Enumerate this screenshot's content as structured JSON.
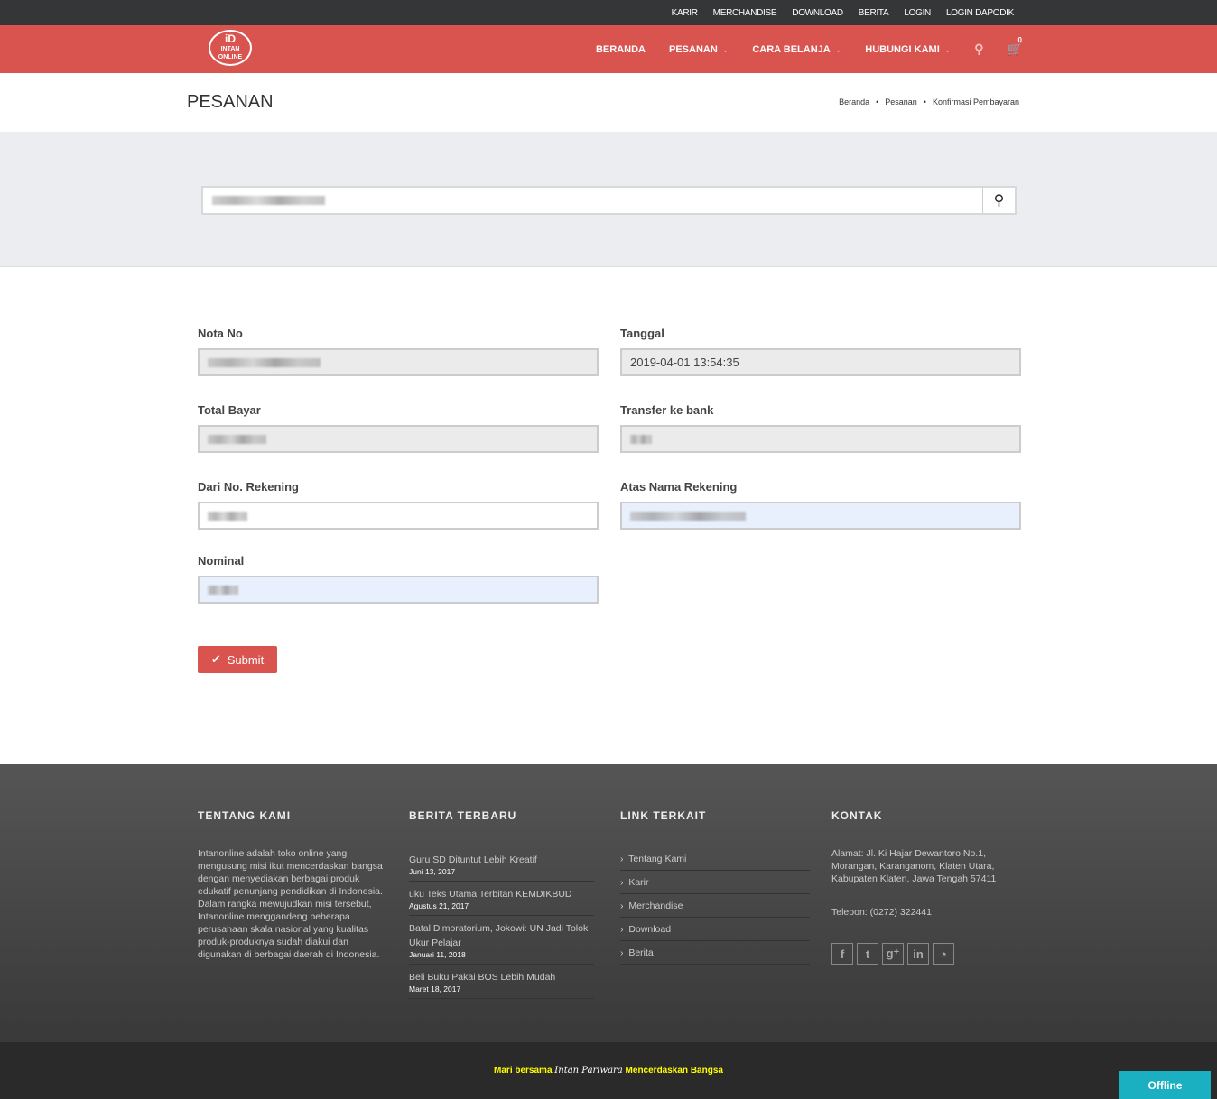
{
  "topbar": {
    "items": [
      "KARIR",
      "MERCHANDISE",
      "DOWNLOAD",
      "BERITA",
      "LOGIN",
      "LOGIN DAPODIK"
    ]
  },
  "nav": {
    "logo": "INTAN ONLINE",
    "items": [
      "BERANDA",
      "PESANAN",
      "CARA BELANJA",
      "HUBUNGI KAMI"
    ],
    "cart_count": "0"
  },
  "page": {
    "title": "PESANAN",
    "breadcrumb": [
      "Beranda",
      "Pesanan",
      "Konfirmasi Pembayaran"
    ]
  },
  "form": {
    "nota_label": "Nota No",
    "tanggal_label": "Tanggal",
    "tanggal_value": "2019-04-01 13:54:35",
    "total_label": "Total Bayar",
    "bank_label": "Transfer ke bank",
    "rek_label": "Dari No. Rekening",
    "nama_label": "Atas Nama Rekening",
    "nominal_label": "Nominal",
    "submit": "Submit"
  },
  "footer": {
    "about_title": "TENTANG KAMI",
    "about_text": "Intanonline adalah toko online yang mengusung misi ikut mencerdaskan bangsa dengan menyediakan berbagai produk edukatif penunjang pendidikan di Indonesia. Dalam rangka mewujudkan misi tersebut, Intanonline menggandeng beberapa perusahaan skala nasional yang kualitas produk-produknya sudah diakui dan digunakan di berbagai daerah di Indonesia.",
    "news_title": "BERITA TERBARU",
    "news": [
      {
        "title": "Guru SD Dituntut Lebih Kreatif",
        "date": "Juni 13, 2017"
      },
      {
        "title": "uku Teks Utama Terbitan KEMDIKBUD",
        "date": "Agustus 21, 2017"
      },
      {
        "title": "Batal Dimoratorium, Jokowi: UN Jadi Tolok Ukur Pelajar",
        "date": "Januari 11, 2018"
      },
      {
        "title": "Beli Buku Pakai BOS Lebih Mudah",
        "date": "Maret 18, 2017"
      }
    ],
    "links_title": "LINK TERKAIT",
    "links": [
      "Tentang Kami",
      "Karir",
      "Merchandise",
      "Download",
      "Berita"
    ],
    "contact_title": "KONTAK",
    "address": "Alamat: Jl. Ki Hajar Dewantoro No.1, Morangan, Karanganom, Klaten Utara, Kabupaten Klaten, Jawa Tengah 57411",
    "phone": "Telepon: (0272) 322441",
    "social": [
      "facebook-icon",
      "twitter-icon",
      "google-plus-icon",
      "linkedin-icon",
      "rss-icon"
    ]
  },
  "bottom": {
    "pre": "Mari bersama ",
    "brand": "Intan Pariwara",
    "post": " Mencerdaskan Bangsa"
  },
  "chat": {
    "status": "Offline"
  },
  "colors": {
    "accent": "#d9534f",
    "chat": "#1ab0c1"
  }
}
